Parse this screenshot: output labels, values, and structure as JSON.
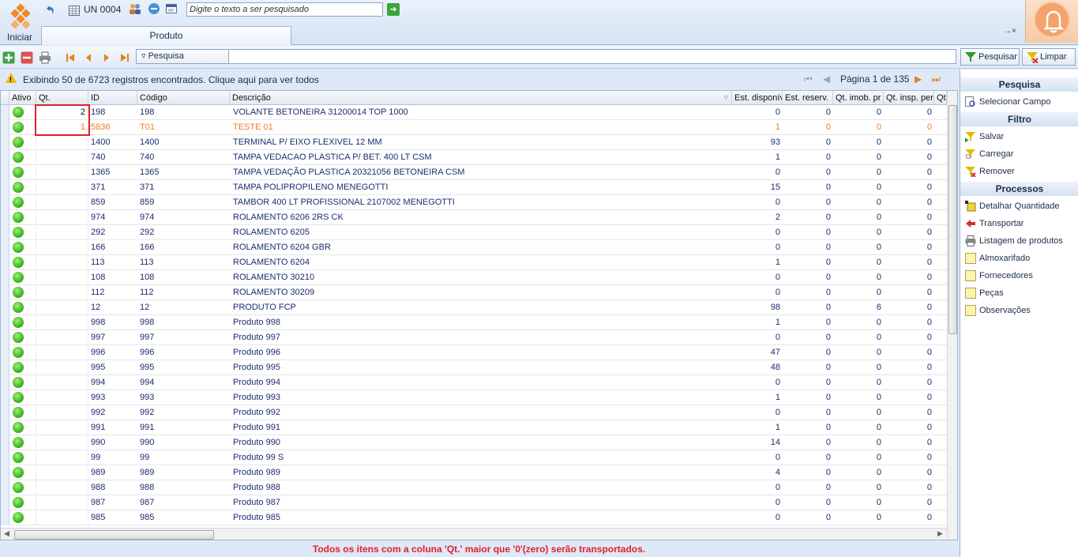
{
  "app": {
    "start_label": "Iniciar",
    "unit_label": "UN 0004",
    "global_search_placeholder": "Digite o texto a ser pesquisado",
    "tab_label": "Produto",
    "tab_controls": "→×"
  },
  "toolbar": {
    "field_select": "Pesquisa",
    "search_value": "",
    "search_button": "Pesquisar",
    "clear_button": "Limpar"
  },
  "info": {
    "message": "Exibindo 50 de 6723 registros encontrados. Clique aqui para ver todos",
    "page_label": "Página 1 de 135"
  },
  "grid": {
    "columns": [
      "Ativo",
      "Qt.",
      "ID",
      "Código",
      "Descrição",
      "Est. disponív",
      "Est. reserv.",
      "Qt. imob. pr",
      "Qt. insp. per",
      "Qt"
    ],
    "rows": [
      {
        "qt": "2",
        "id": "198",
        "codigo": "198",
        "descricao": "VOLANTE BETONEIRA 31200014 TOP 1000",
        "est_disp": "0",
        "est_reserv": "0",
        "qt_imob": "0",
        "qt_insp": "0",
        "highlight": false
      },
      {
        "qt": "1",
        "id": "5836",
        "codigo": "T01",
        "descricao": "TESTE 01",
        "est_disp": "1",
        "est_reserv": "0",
        "qt_imob": "0",
        "qt_insp": "0",
        "highlight": true
      },
      {
        "qt": "",
        "id": "1400",
        "codigo": "1400",
        "descricao": "TERMINAL P/ EIXO FLEXIVEL 12 MM",
        "est_disp": "93",
        "est_reserv": "0",
        "qt_imob": "0",
        "qt_insp": "0",
        "highlight": false
      },
      {
        "qt": "",
        "id": "740",
        "codigo": "740",
        "descricao": "TAMPA VEDACAO PLASTICA P/ BET. 400 LT CSM",
        "est_disp": "1",
        "est_reserv": "0",
        "qt_imob": "0",
        "qt_insp": "0",
        "highlight": false
      },
      {
        "qt": "",
        "id": "1365",
        "codigo": "1365",
        "descricao": "TAMPA VEDAÇÃO PLASTICA 20321056 BETONEIRA CSM",
        "est_disp": "0",
        "est_reserv": "0",
        "qt_imob": "0",
        "qt_insp": "0",
        "highlight": false
      },
      {
        "qt": "",
        "id": "371",
        "codigo": "371",
        "descricao": "TAMPA POLIPROPILENO MENEGOTTI",
        "est_disp": "15",
        "est_reserv": "0",
        "qt_imob": "0",
        "qt_insp": "0",
        "highlight": false
      },
      {
        "qt": "",
        "id": "859",
        "codigo": "859",
        "descricao": "TAMBOR 400 LT PROFISSIONAL 2107002 MENEGOTTI",
        "est_disp": "0",
        "est_reserv": "0",
        "qt_imob": "0",
        "qt_insp": "0",
        "highlight": false
      },
      {
        "qt": "",
        "id": "974",
        "codigo": "974",
        "descricao": "ROLAMENTO 6206 2RS CK",
        "est_disp": "2",
        "est_reserv": "0",
        "qt_imob": "0",
        "qt_insp": "0",
        "highlight": false
      },
      {
        "qt": "",
        "id": "292",
        "codigo": "292",
        "descricao": "ROLAMENTO 6205",
        "est_disp": "0",
        "est_reserv": "0",
        "qt_imob": "0",
        "qt_insp": "0",
        "highlight": false
      },
      {
        "qt": "",
        "id": "166",
        "codigo": "166",
        "descricao": "ROLAMENTO 6204 GBR",
        "est_disp": "0",
        "est_reserv": "0",
        "qt_imob": "0",
        "qt_insp": "0",
        "highlight": false
      },
      {
        "qt": "",
        "id": "113",
        "codigo": "113",
        "descricao": "ROLAMENTO 6204",
        "est_disp": "1",
        "est_reserv": "0",
        "qt_imob": "0",
        "qt_insp": "0",
        "highlight": false
      },
      {
        "qt": "",
        "id": "108",
        "codigo": "108",
        "descricao": "ROLAMENTO 30210",
        "est_disp": "0",
        "est_reserv": "0",
        "qt_imob": "0",
        "qt_insp": "0",
        "highlight": false
      },
      {
        "qt": "",
        "id": "112",
        "codigo": "112",
        "descricao": "ROLAMENTO 30209",
        "est_disp": "0",
        "est_reserv": "0",
        "qt_imob": "0",
        "qt_insp": "0",
        "highlight": false
      },
      {
        "qt": "",
        "id": "12",
        "codigo": "12",
        "descricao": "PRODUTO FCP",
        "est_disp": "98",
        "est_reserv": "0",
        "qt_imob": "6",
        "qt_insp": "0",
        "highlight": false
      },
      {
        "qt": "",
        "id": "998",
        "codigo": "998",
        "descricao": "Produto 998",
        "est_disp": "1",
        "est_reserv": "0",
        "qt_imob": "0",
        "qt_insp": "0",
        "highlight": false
      },
      {
        "qt": "",
        "id": "997",
        "codigo": "997",
        "descricao": "Produto 997",
        "est_disp": "0",
        "est_reserv": "0",
        "qt_imob": "0",
        "qt_insp": "0",
        "highlight": false
      },
      {
        "qt": "",
        "id": "996",
        "codigo": "996",
        "descricao": "Produto 996",
        "est_disp": "47",
        "est_reserv": "0",
        "qt_imob": "0",
        "qt_insp": "0",
        "highlight": false
      },
      {
        "qt": "",
        "id": "995",
        "codigo": "995",
        "descricao": "Produto 995",
        "est_disp": "48",
        "est_reserv": "0",
        "qt_imob": "0",
        "qt_insp": "0",
        "highlight": false
      },
      {
        "qt": "",
        "id": "994",
        "codigo": "994",
        "descricao": "Produto 994",
        "est_disp": "0",
        "est_reserv": "0",
        "qt_imob": "0",
        "qt_insp": "0",
        "highlight": false
      },
      {
        "qt": "",
        "id": "993",
        "codigo": "993",
        "descricao": "Produto 993",
        "est_disp": "1",
        "est_reserv": "0",
        "qt_imob": "0",
        "qt_insp": "0",
        "highlight": false
      },
      {
        "qt": "",
        "id": "992",
        "codigo": "992",
        "descricao": "Produto 992",
        "est_disp": "0",
        "est_reserv": "0",
        "qt_imob": "0",
        "qt_insp": "0",
        "highlight": false
      },
      {
        "qt": "",
        "id": "991",
        "codigo": "991",
        "descricao": "Produto 991",
        "est_disp": "1",
        "est_reserv": "0",
        "qt_imob": "0",
        "qt_insp": "0",
        "highlight": false
      },
      {
        "qt": "",
        "id": "990",
        "codigo": "990",
        "descricao": "Produto 990",
        "est_disp": "14",
        "est_reserv": "0",
        "qt_imob": "0",
        "qt_insp": "0",
        "highlight": false
      },
      {
        "qt": "",
        "id": "99",
        "codigo": "99",
        "descricao": "Produto 99 S",
        "est_disp": "0",
        "est_reserv": "0",
        "qt_imob": "0",
        "qt_insp": "0",
        "highlight": false
      },
      {
        "qt": "",
        "id": "989",
        "codigo": "989",
        "descricao": "Produto 989",
        "est_disp": "4",
        "est_reserv": "0",
        "qt_imob": "0",
        "qt_insp": "0",
        "highlight": false
      },
      {
        "qt": "",
        "id": "988",
        "codigo": "988",
        "descricao": "Produto 988",
        "est_disp": "0",
        "est_reserv": "0",
        "qt_imob": "0",
        "qt_insp": "0",
        "highlight": false
      },
      {
        "qt": "",
        "id": "987",
        "codigo": "987",
        "descricao": "Produto 987",
        "est_disp": "0",
        "est_reserv": "0",
        "qt_imob": "0",
        "qt_insp": "0",
        "highlight": false
      },
      {
        "qt": "",
        "id": "985",
        "codigo": "985",
        "descricao": "Produto 985",
        "est_disp": "0",
        "est_reserv": "0",
        "qt_imob": "0",
        "qt_insp": "0",
        "highlight": false
      }
    ]
  },
  "footer": {
    "message": "Todos os itens com a coluna 'Qt.' maior que '0'(zero) serão transportados."
  },
  "side_panel": {
    "pesquisa_title": "Pesquisa",
    "selecionar_campo": "Selecionar Campo",
    "filtro_title": "Filtro",
    "salvar": "Salvar",
    "carregar": "Carregar",
    "remover": "Remover",
    "processos_title": "Processos",
    "detalhar_quantidade": "Detalhar Quantidade",
    "transportar": "Transportar",
    "listagem_produtos": "Listagem de produtos",
    "almoxarifado": "Almoxarifado",
    "fornecedores": "Fornecedores",
    "pecas": "Peças",
    "observacoes": "Observações"
  },
  "colors": {
    "highlight_text": "#f07c1c",
    "warning_text": "#e0202a",
    "active_dot": "#2fae17"
  }
}
